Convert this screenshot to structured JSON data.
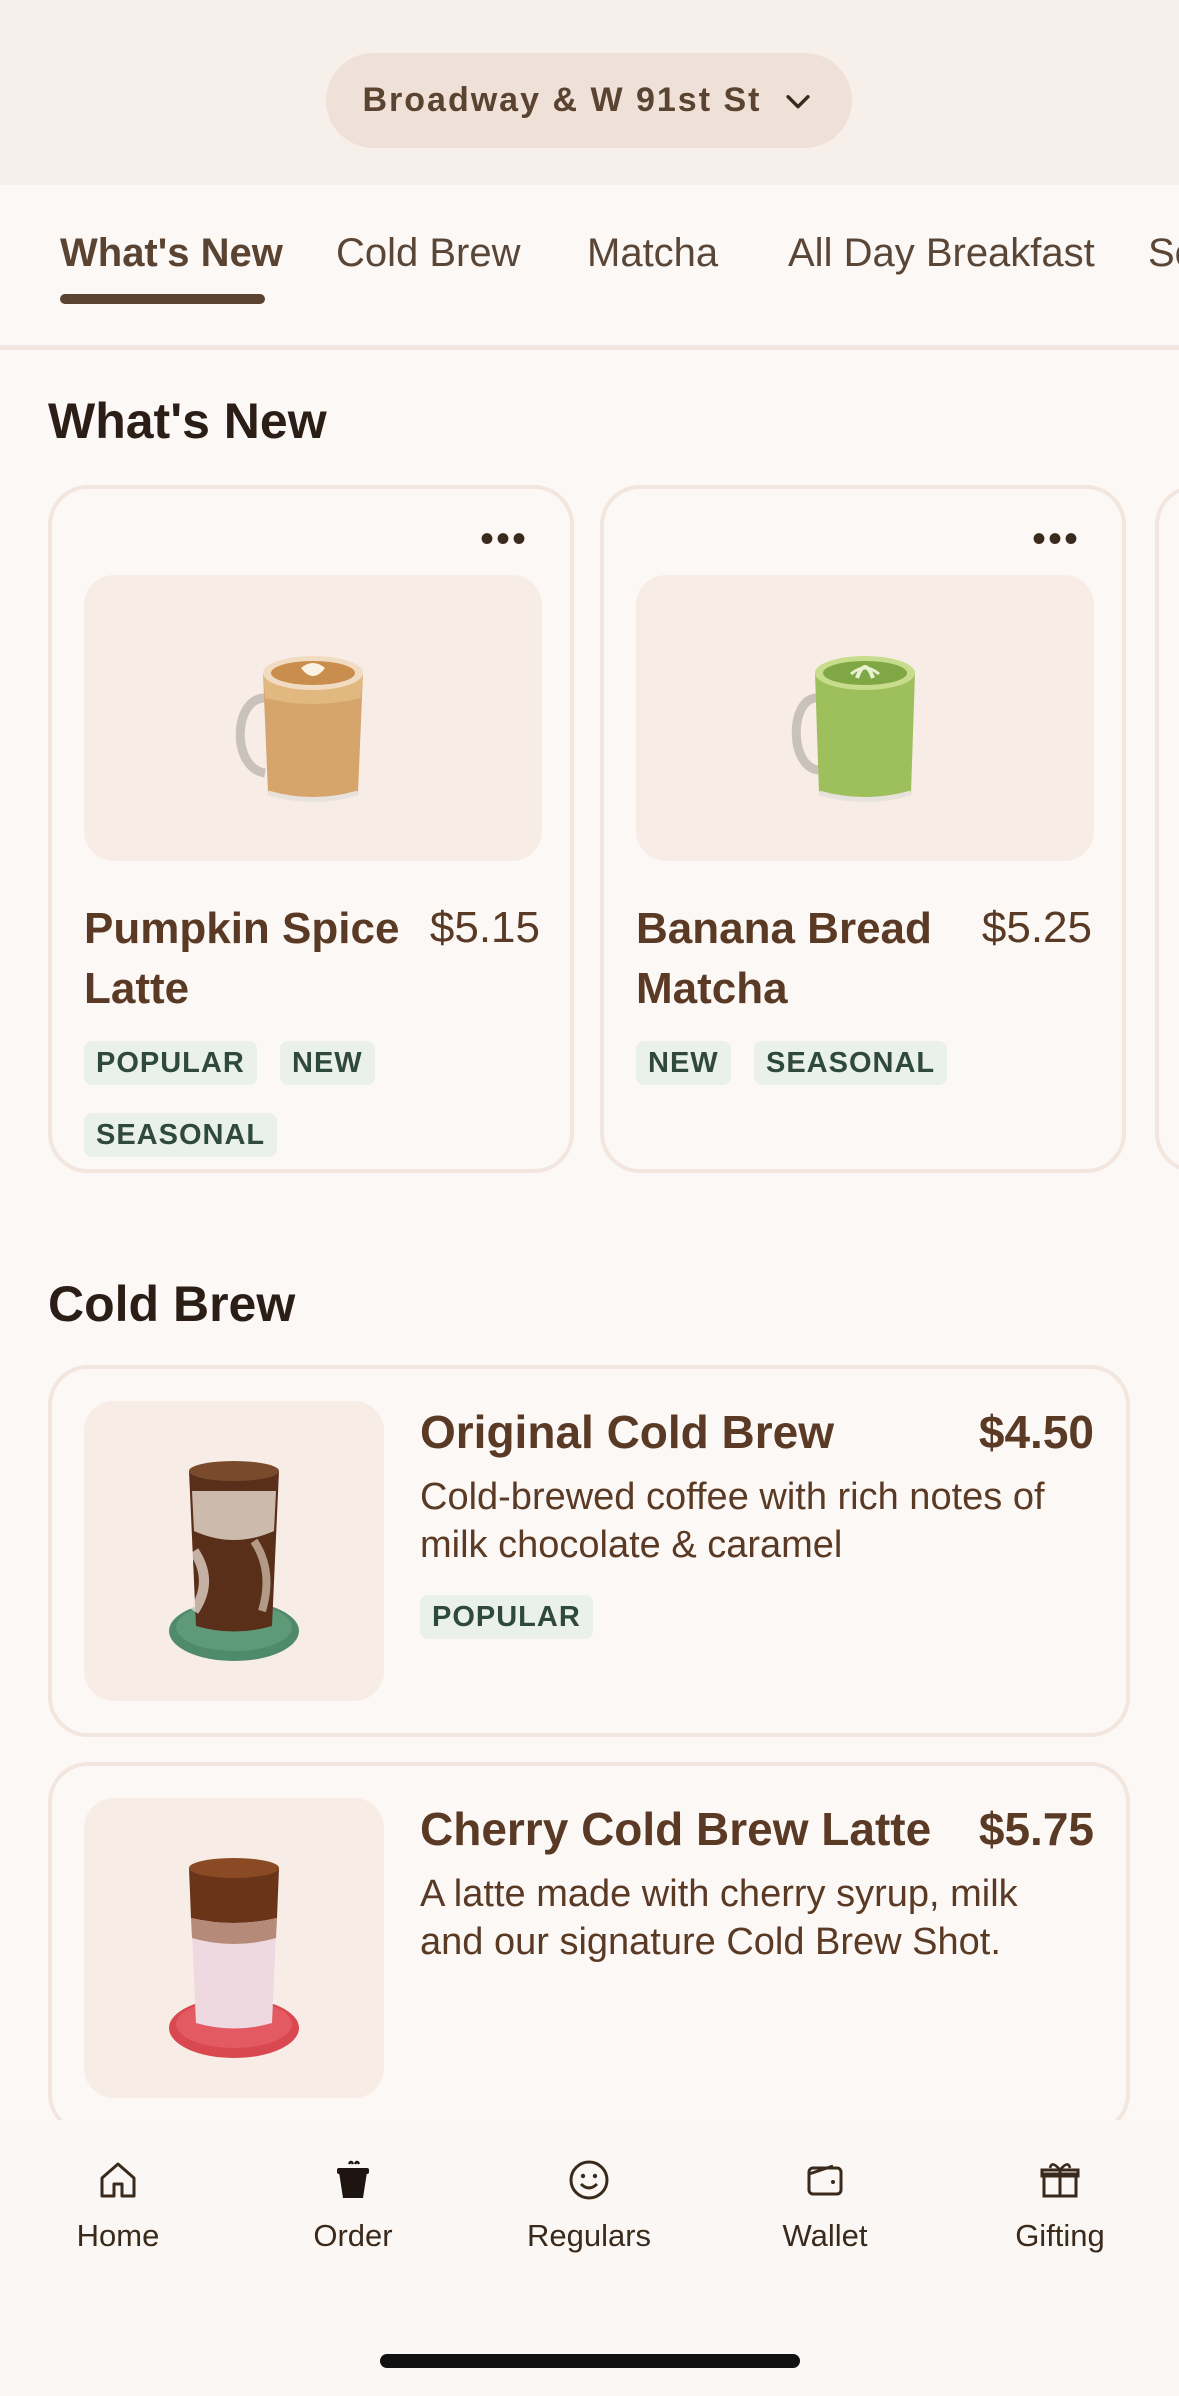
{
  "header": {
    "location": "Broadway & W 91st St",
    "chevron_icon": "chevron-down-icon"
  },
  "tabs": [
    {
      "label": "What's New",
      "active": true
    },
    {
      "label": "Cold Brew",
      "active": false
    },
    {
      "label": "Matcha",
      "active": false
    },
    {
      "label": "All Day Breakfast",
      "active": false
    },
    {
      "label": "Se",
      "active": false
    }
  ],
  "whats_new": {
    "title": "What's New",
    "items": [
      {
        "name_line1": "Pumpkin Spice",
        "name_line2": "Latte",
        "price": "$5.15",
        "tags": [
          "POPULAR",
          "NEW",
          "SEASONAL"
        ],
        "more": "•••",
        "image": "latte-mug-icon"
      },
      {
        "name_line1": "Banana Bread",
        "name_line2": "Matcha",
        "price": "$5.25",
        "tags": [
          "NEW",
          "SEASONAL"
        ],
        "more": "•••",
        "image": "matcha-mug-icon"
      }
    ]
  },
  "cold_brew": {
    "title": "Cold Brew",
    "items": [
      {
        "name": "Original Cold Brew",
        "price": "$4.50",
        "desc_line1": "Cold-brewed coffee with rich notes of",
        "desc_line2": "milk chocolate & caramel",
        "tags": [
          "POPULAR"
        ],
        "image": "iced-coffee-cup-icon",
        "coaster_color": "#4f8a6a"
      },
      {
        "name": "Cherry Cold Brew Latte",
        "price": "$5.75",
        "desc_line1": "A latte made with cherry syrup, milk",
        "desc_line2": "and our signature Cold Brew Shot.",
        "tags": [],
        "image": "iced-latte-cup-icon",
        "coaster_color": "#d9474f"
      }
    ]
  },
  "bottom_nav": [
    {
      "label": "Home",
      "icon": "home-icon"
    },
    {
      "label": "Order",
      "icon": "coffee-cup-icon"
    },
    {
      "label": "Regulars",
      "icon": "smiley-icon"
    },
    {
      "label": "Wallet",
      "icon": "wallet-icon"
    },
    {
      "label": "Gifting",
      "icon": "gift-icon"
    }
  ],
  "colors": {
    "accent_brown": "#5a4330",
    "tag_bg": "#eaf1ec",
    "tag_text": "#2f4a3c",
    "card_image_bg": "#f8ece6"
  }
}
